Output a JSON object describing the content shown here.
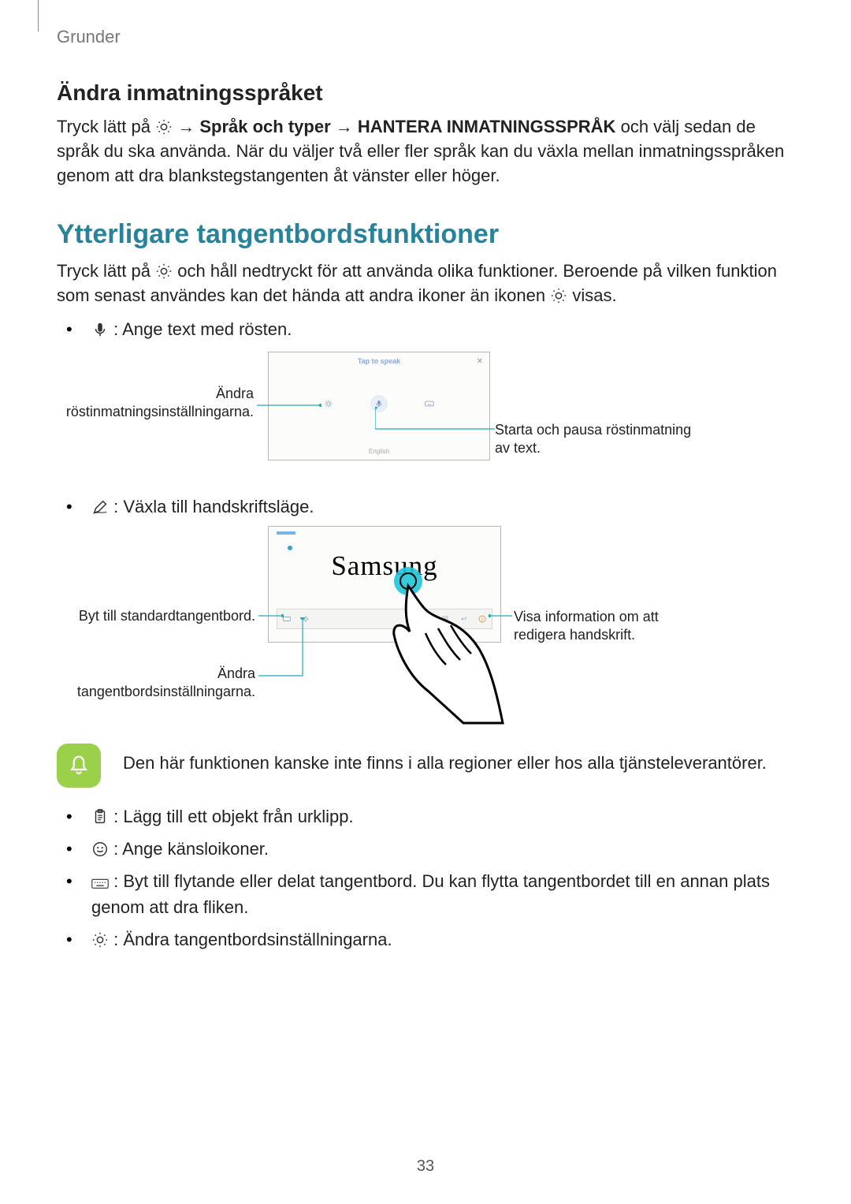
{
  "header": {
    "breadcrumb": "Grunder"
  },
  "s1": {
    "title": "Ändra inmatningsspråket",
    "p_a": "Tryck lätt på ",
    "p_b": " → ",
    "p_bold1": "Språk och typer",
    "p_c": " → ",
    "p_bold2": "HANTERA INMATNINGSSPRÅK",
    "p_d": " och välj sedan de språk du ska använda. När du väljer två eller fler språk kan du växla mellan inmatningsspråken genom att dra blankstegstangenten åt vänster eller höger."
  },
  "s2": {
    "title": "Ytterligare tangentbordsfunktioner",
    "p_a": "Tryck lätt på ",
    "p_b": " och håll nedtryckt för att använda olika funktioner. Beroende på vilken funktion som senast användes kan det hända att andra ikoner än ikonen ",
    "p_c": " visas."
  },
  "list": {
    "mic": " : Ange text med rösten.",
    "pen": " : Växla till handskriftsläge.",
    "clip": " : Lägg till ett objekt från urklipp.",
    "smile": " : Ange känsloikoner.",
    "float": " : Byt till flytande eller delat tangentbord. Du kan flytta tangentbordet till en annan plats genom att dra fliken.",
    "gear": " : Ändra tangentbordsinställningarna."
  },
  "d1": {
    "tap": "Tap to speak",
    "lang": "English",
    "left": "Ändra röstinmatningsinställningarna.",
    "right": "Starta och pausa röstinmatning av text."
  },
  "d2": {
    "handwriting": "Samsung",
    "left1": "Byt till standardtangentbord.",
    "left2": "Ändra tangentbordsinställningarna.",
    "right": "Visa information om att redigera handskrift."
  },
  "note": "Den här funktionen kanske inte finns i alla regioner eller hos alla tjänsteleverantörer.",
  "page_number": "33"
}
